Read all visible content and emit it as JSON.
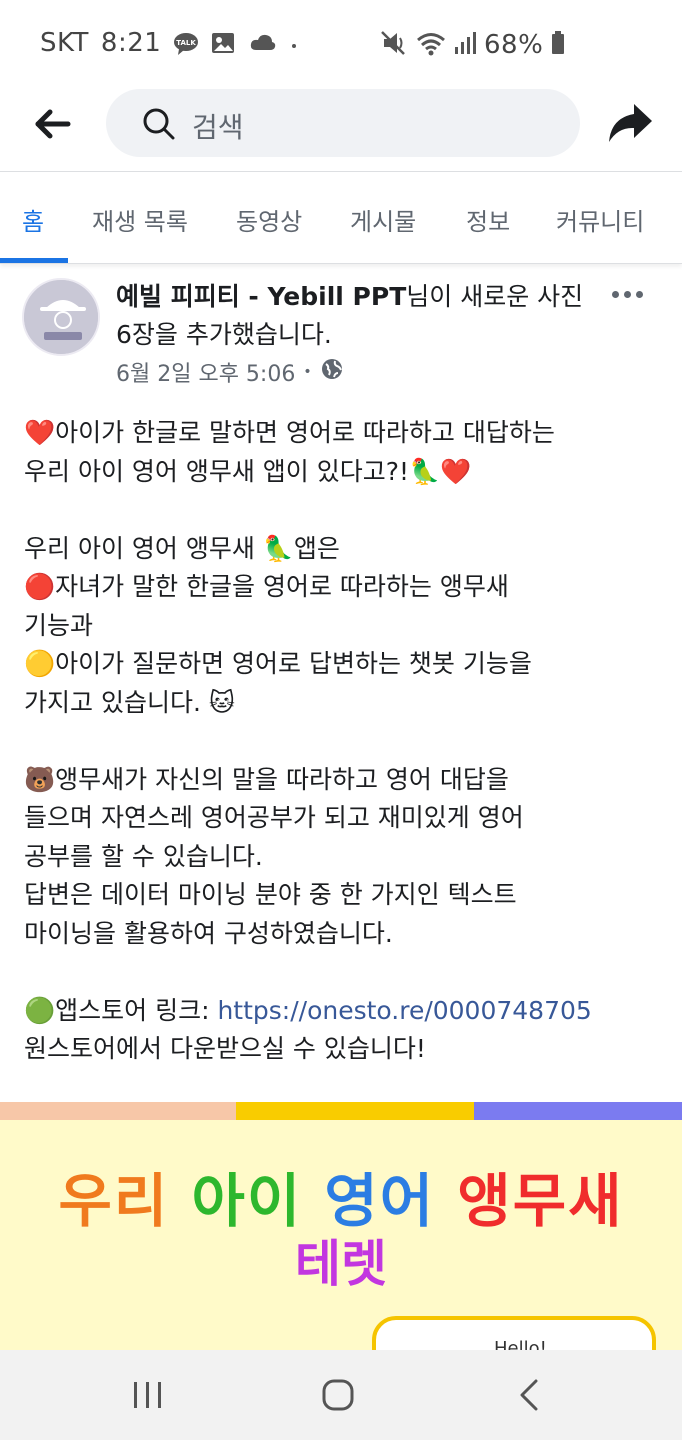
{
  "status_bar": {
    "carrier": "SKT",
    "time": "8:21",
    "battery": "68%",
    "icons": [
      "kakaotalk-icon",
      "gallery-icon",
      "cloud-icon",
      "mute-icon",
      "wifi-icon",
      "signal-icon",
      "battery-icon"
    ]
  },
  "search": {
    "placeholder": "검색"
  },
  "tabs": [
    {
      "label": "홈",
      "active": true
    },
    {
      "label": "재생 목록"
    },
    {
      "label": "동영상"
    },
    {
      "label": "게시물"
    },
    {
      "label": "정보"
    },
    {
      "label": "커뮤니티"
    }
  ],
  "post": {
    "page_name": "예빌 피피티 - Yebill PPT",
    "action": "님이 새로운 사진 6장을 추가했습니다.",
    "date": "6월 2일 오후 5:06",
    "privacy_icon": "globe-icon",
    "lines": [
      "❤️아이가 한글로 말하면 영어로 따라하고 대답하는",
      "우리 아이 영어 앵무새 앱이 있다고?!🦜❤️",
      "",
      "우리 아이 영어 앵무새 🦜앱은",
      "🔴자녀가 말한 한글을 영어로 따라하는 앵무새",
      "기능과",
      "🟡아이가 질문하면 영어로 답변하는 챗봇 기능을",
      "가지고 있습니다. 🐱",
      "",
      "🐻앵무새가 자신의 말을 따라하고 영어 대답을",
      "들으며 자연스레 영어공부가 되고 재미있게 영어",
      "공부를 할 수 있습니다.",
      "답변은 데이터 마이닝 분야 중 한 가지인 텍스트",
      "마이닝을 활용하여 구성하였습니다.",
      "",
      "🟢앱스토어 링크: ",
      "원스토어에서 다운받으실 수 있습니다!"
    ],
    "link": "https://onesto.re/0000748705"
  },
  "image": {
    "title_words": [
      {
        "text": "우리",
        "color": "#f07a1e"
      },
      {
        "text": "아이",
        "color": "#2db72d"
      },
      {
        "text": "영어",
        "color": "#2b7de3"
      },
      {
        "text": "앵무새",
        "color": "#f02c2c"
      }
    ],
    "subtitle": "테렛",
    "bubble_text": "Hello!",
    "stripe_colors": [
      "#f7c7a8",
      "#f9cc00",
      "#7b7bf0"
    ]
  },
  "nav": {
    "icons": [
      "recent-apps-icon",
      "home-icon",
      "back-icon"
    ]
  }
}
